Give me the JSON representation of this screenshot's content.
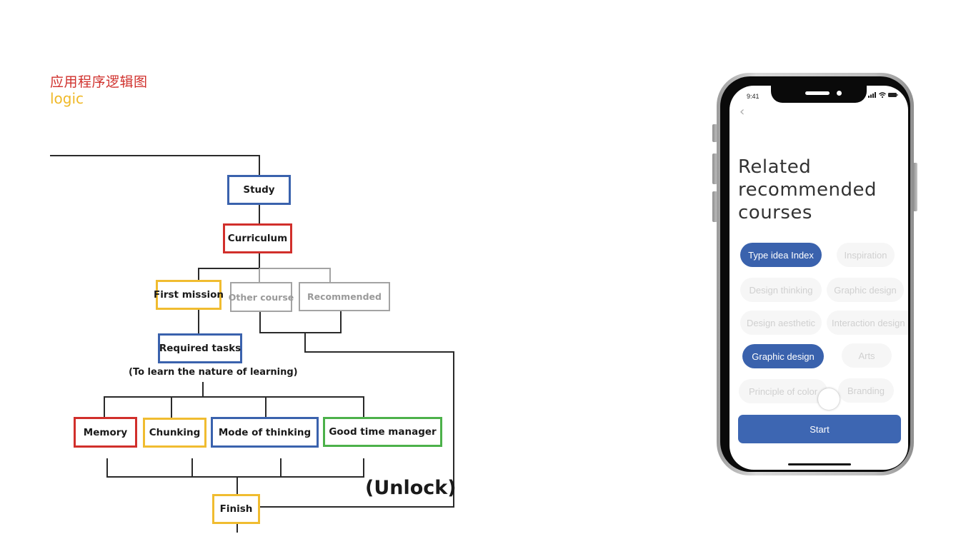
{
  "header": {
    "title_cn": "应用程序逻辑图",
    "title_en": "logic"
  },
  "colors": {
    "red": "#d12f2b",
    "yellow": "#f0bc30",
    "blue": "#3a62ad",
    "green": "#4cb14a",
    "gray": "#a3a3a3",
    "line": "#2a2a2a"
  },
  "flowchart": {
    "nodes": {
      "study": "Study",
      "curriculum": "Curriculum",
      "first_mission": "First mission",
      "other_course": "Other course",
      "recommended": "Recommended",
      "required_tasks": "Required tasks",
      "memory": "Memory",
      "chunking": "Chunking",
      "mode_of_thinking": "Mode of thinking",
      "good_time_manager": "Good time manager",
      "finish": "Finish"
    },
    "note": "(To learn the nature of learning)",
    "unlock_label": "(Unlock)"
  },
  "phone": {
    "status_time": "9:41",
    "back_icon": "chevron-left",
    "headline": "Related recommended courses",
    "chips": [
      {
        "label": "Type idea Index",
        "selected": true
      },
      {
        "label": "Inspiration",
        "selected": false
      },
      {
        "label": "Design thinking",
        "selected": false
      },
      {
        "label": "Graphic design",
        "selected": false
      },
      {
        "label": "Design aesthetic",
        "selected": false
      },
      {
        "label": "Interaction design",
        "selected": false
      },
      {
        "label": "Graphic design",
        "selected": true
      },
      {
        "label": "Arts",
        "selected": false
      },
      {
        "label": "Principle of color",
        "selected": false
      },
      {
        "label": "Branding",
        "selected": false
      }
    ],
    "start_label": "Start"
  }
}
